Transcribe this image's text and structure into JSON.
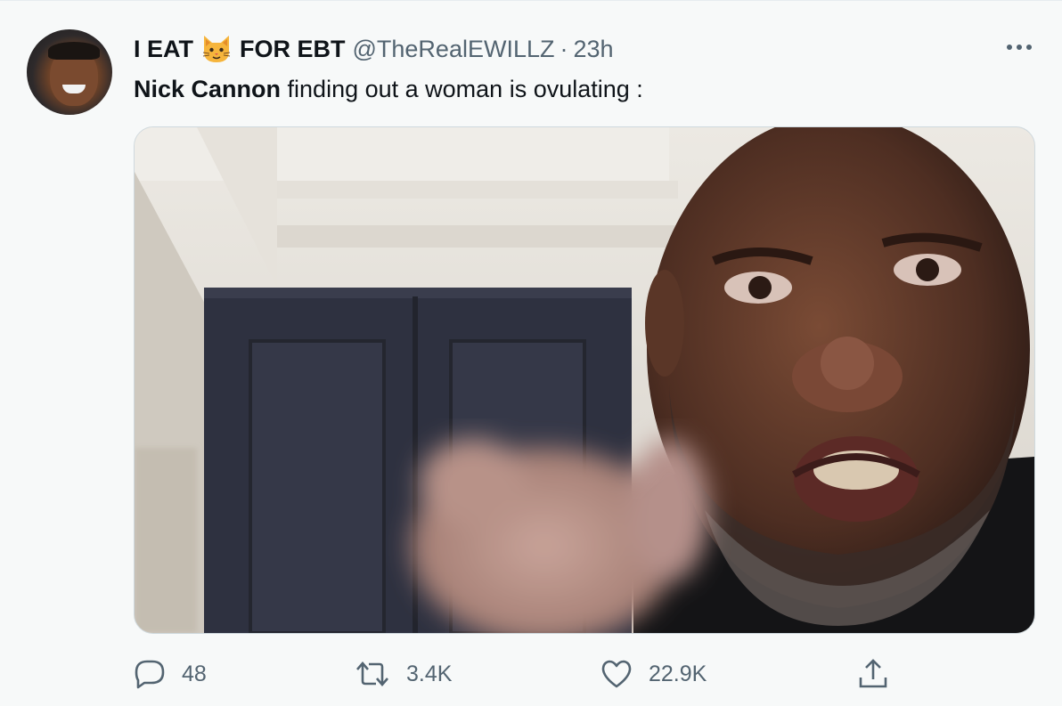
{
  "tweet": {
    "display_name_prefix": "I EAT",
    "display_name_suffix": "FOR EBT",
    "name_emoji_icon": "cat-face-icon",
    "handle": "@TheRealEWILLZ",
    "separator": "·",
    "time": "23h",
    "text_bold": "Nick Cannon",
    "text_rest": " finding out a woman is ovulating :",
    "more_icon": "more-dots-icon"
  },
  "actions": {
    "reply_count": "48",
    "retweet_count": "3.4K",
    "like_count": "22.9K"
  },
  "colors": {
    "background": "#f7f9f9",
    "primary_text": "#0f1419",
    "secondary_text": "#536471"
  }
}
